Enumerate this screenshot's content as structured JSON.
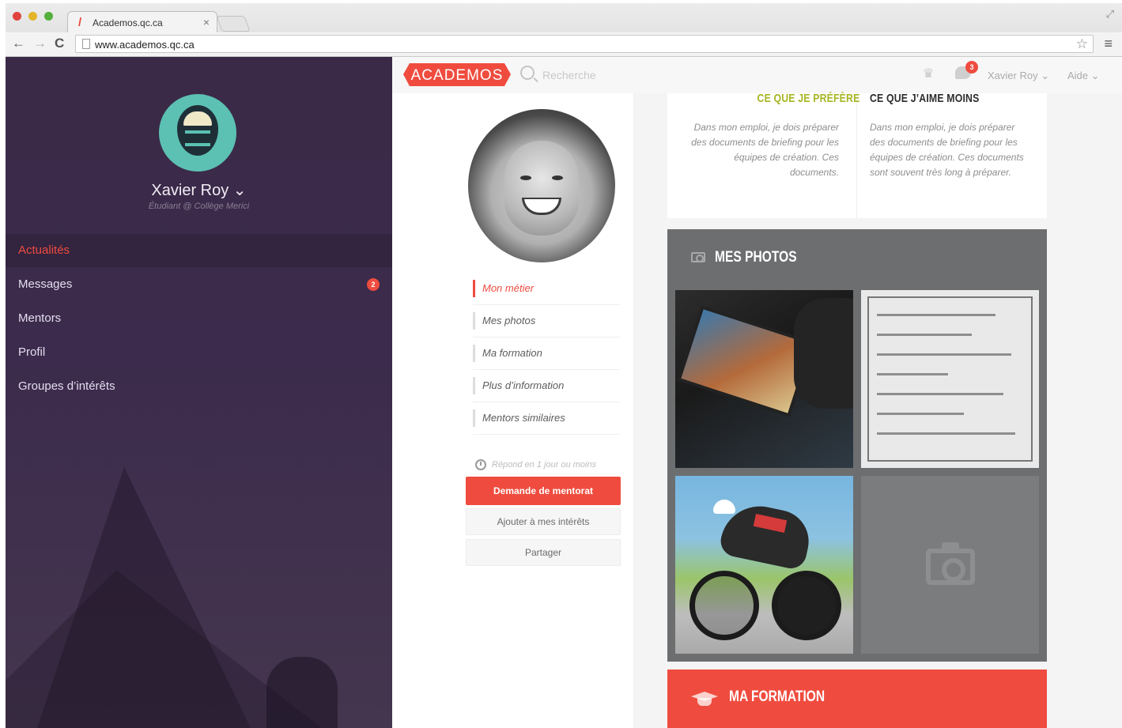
{
  "browser": {
    "tab_title": "Academos.qc.ca",
    "tab_close": "×",
    "url": "www.academos.qc.ca",
    "back": "←",
    "forward": "→",
    "reload": "C",
    "star": "☆",
    "menu": "≡"
  },
  "sidebar": {
    "user_name": "Xavier Roy ⌄",
    "user_subtitle": "Étudiant @ Collège Merici",
    "items": [
      {
        "label": "Actualités",
        "active": true
      },
      {
        "label": "Messages",
        "badge": "2"
      },
      {
        "label": "Mentors"
      },
      {
        "label": "Profil"
      },
      {
        "label": "Groupes d’intérêts"
      }
    ]
  },
  "header": {
    "logo": "ACADEMOS",
    "search_placeholder": "Recherche",
    "notification_count": "3",
    "user_menu": "Xavier Roy ⌄",
    "help_menu": "Aide ⌄"
  },
  "profile": {
    "nav": [
      {
        "label": "Mon métier",
        "active": true
      },
      {
        "label": "Mes photos"
      },
      {
        "label": "Ma formation"
      },
      {
        "label": "Plus d’information"
      },
      {
        "label": "Mentors similaires"
      }
    ],
    "response_time": "Répond en 1 jour ou moins",
    "primary_button": "Demande de mentorat",
    "add_interests_button": "Ajouter à mes intérêts",
    "share_button": "Partager"
  },
  "content": {
    "prefer_title": "CE QUE JE PRÉFÈRE",
    "prefer_text": "Dans mon emploi, je dois préparer des documents de briefing pour les équipes de création. Ces documents.",
    "dislike_title": "CE QUE J’AIME MOINS",
    "dislike_text": "Dans mon emploi, je dois préparer des documents de briefing pour les équipes de création. Ces documents sont souvent très long à préparer.",
    "photos_title": "MES PHOTOS",
    "formation_title": "MA FORMATION"
  },
  "colors": {
    "accent": "#ef4c3f",
    "sidebar_bg": "#3c2b4c",
    "prefer_title": "#a7b524",
    "photos_bg": "#6d6e70"
  }
}
